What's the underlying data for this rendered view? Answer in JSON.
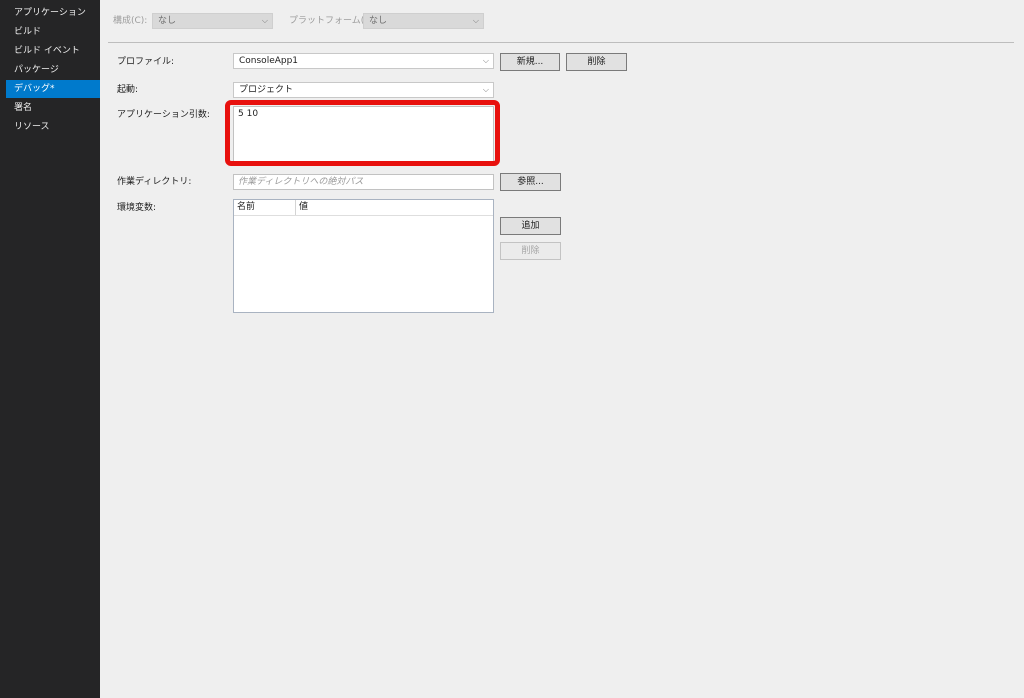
{
  "sidebar": {
    "items": [
      {
        "label": "アプリケーション",
        "active": false
      },
      {
        "label": "ビルド",
        "active": false
      },
      {
        "label": "ビルド イベント",
        "active": false
      },
      {
        "label": "パッケージ",
        "active": false
      },
      {
        "label": "デバッグ*",
        "active": true
      },
      {
        "label": "署名",
        "active": false
      },
      {
        "label": "リソース",
        "active": false
      }
    ]
  },
  "toolbar": {
    "configuration_label": "構成(C):",
    "configuration_value": "なし",
    "platform_label": "プラットフォーム(M):",
    "platform_value": "なし"
  },
  "profile": {
    "label": "プロファイル:",
    "value": "ConsoleApp1",
    "new_button": "新規...",
    "delete_button": "削除"
  },
  "launch": {
    "label": "起動:",
    "value": "プロジェクト"
  },
  "app_args": {
    "label": "アプリケーション引数:",
    "value": "5 10"
  },
  "working_dir": {
    "label": "作業ディレクトリ:",
    "placeholder": "作業ディレクトリへの絶対パス",
    "browse_button": "参照..."
  },
  "env_vars": {
    "label": "環境変数:",
    "columns": [
      "名前",
      "値"
    ],
    "add_button": "追加",
    "delete_button": "削除"
  },
  "colors": {
    "accent": "#007acc",
    "highlight": "#e8110e",
    "sidebar_bg": "#252526"
  }
}
